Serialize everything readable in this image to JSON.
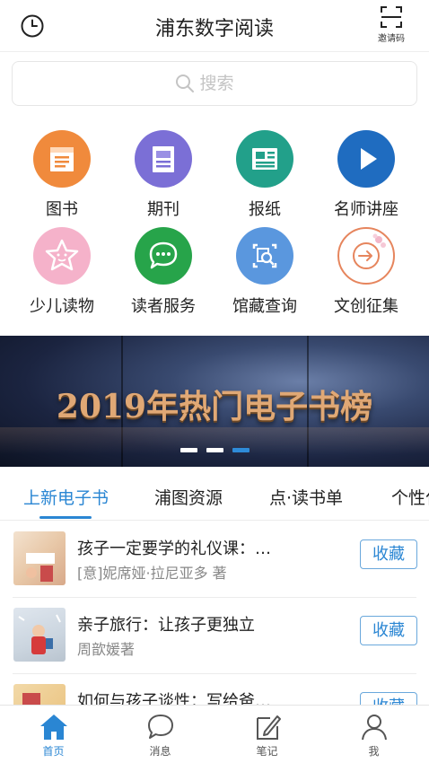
{
  "header": {
    "title": "浦东数字阅读",
    "invite_label": "邀请码"
  },
  "search": {
    "placeholder": "搜索"
  },
  "categories": [
    {
      "label": "图书",
      "icon": "book-icon",
      "color": "#f08a3c"
    },
    {
      "label": "期刊",
      "icon": "magazine-icon",
      "color": "#7b6fd6"
    },
    {
      "label": "报纸",
      "icon": "newspaper-icon",
      "color": "#22a08a"
    },
    {
      "label": "名师讲座",
      "icon": "play-icon",
      "color": "#1f6cc0"
    },
    {
      "label": "少儿读物",
      "icon": "star-face-icon",
      "color": "#f2a3c0"
    },
    {
      "label": "读者服务",
      "icon": "chat-icon",
      "color": "#27a44a"
    },
    {
      "label": "馆藏查询",
      "icon": "search-frame-icon",
      "color": "#5a97de"
    },
    {
      "label": "文创征集",
      "icon": "enter-arrow-icon",
      "color": "#e6855d"
    }
  ],
  "banner": {
    "text": "2019年热门电子书榜",
    "slides": 3,
    "active_slide": 3
  },
  "tabs": [
    {
      "label": "上新电子书",
      "active": true
    },
    {
      "label": "浦图资源",
      "active": false
    },
    {
      "label": "点·读书单",
      "active": false
    },
    {
      "label": "个性化",
      "active": false
    }
  ],
  "books": [
    {
      "title": "孩子一定要学的礼仪课：…",
      "author": "[意]妮席娅·拉尼亚多 著",
      "button": "收藏"
    },
    {
      "title": "亲子旅行：让孩子更独立",
      "author": "周歆媛著",
      "button": "收藏"
    },
    {
      "title": "如何与孩子谈性：写给爸…",
      "author": "",
      "button": "收藏"
    }
  ],
  "bottom_nav": [
    {
      "label": "首页",
      "icon": "home-icon",
      "active": true
    },
    {
      "label": "消息",
      "icon": "message-icon",
      "active": false
    },
    {
      "label": "笔记",
      "icon": "note-icon",
      "active": false
    },
    {
      "label": "我",
      "icon": "user-icon",
      "active": false
    }
  ],
  "colors": {
    "accent": "#2a86d3"
  }
}
